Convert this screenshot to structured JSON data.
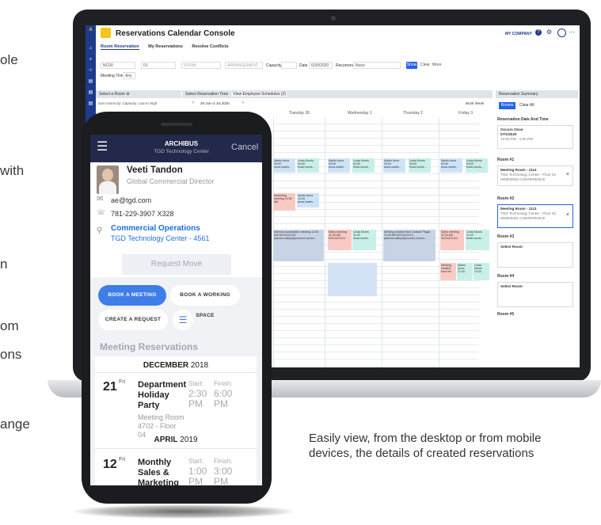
{
  "left_text_fragments": [
    "ole",
    "with",
    "n",
    "om",
    "ons",
    "ange"
  ],
  "caption": "Easily view, from the desktop or from mobile devices, the details of created reservations",
  "desktop": {
    "app_title": "Reservations Calendar Console",
    "brand": "MY COMPANY",
    "tabs": [
      "Room Reservation",
      "My Reservations",
      "Resolve Conflicts"
    ],
    "filters": {
      "site": "NC00",
      "floor": "01",
      "room_placeholder": "ROOM",
      "arrangement_placeholder": "ARRANGEMENT",
      "capacity_label": "Capacity",
      "date_label": "Date",
      "date_value": "6/30/2020",
      "recurrence_label": "Recurrence",
      "recurrence_value": "None",
      "meeting_time_label": "Meeting Time",
      "meeting_time_value": "Any"
    },
    "buttons": {
      "show": "Show",
      "clear": "Clear",
      "more": "More"
    },
    "select_room_header": "Select a Room",
    "sort_label": "Sort rooms by: Capacity: Low to High",
    "select_time_header": "Select Reservation Time",
    "view_schedules": "View Employee Schedules (2)",
    "date_range": "29 Jun–3 Jul 2020",
    "view_mode": "Work Week",
    "days": [
      "Tuesday 30",
      "Wednesday 1",
      "Thursday 2",
      "Friday 3"
    ],
    "events": [
      {
        "text": "Martin Anna 09:00 anna.martin..."
      },
      {
        "text": "Linda Morris 09:00 linda.morris..."
      },
      {
        "text": "Martin Anna 09:00 anna.martin..."
      },
      {
        "text": "Linda Morris 09:00 linda.morris..."
      },
      {
        "text": "Martin Anna 09:00 anna.martin..."
      },
      {
        "text": "Linda Morris 09:00 linda.morris..."
      },
      {
        "text": "Martin Anna 09:00 anna.martin..."
      },
      {
        "text": "Linda Morris 09:00 linda.morris..."
      },
      {
        "text": "Marketing meeting 10:00 AM"
      },
      {
        "text": "Martin Anna 10:00 anna.martin..."
      },
      {
        "text": "Internal coordination meeting 11:00 AM NC01/01/113 paloma.callejo@procos1.onmicr..."
      },
      {
        "text": "Sales meeting 11:00 AM NC01/01/114"
      },
      {
        "text": "Linda Morris 11:00 linda.morris..."
      },
      {
        "text": "Meeting created from Outlook Plugin 11:00 AM NC01/01/113 paloma.callejo@procos1.onmicr..."
      },
      {
        "text": "Sales meeting 11:00 AM NC01/01/114"
      },
      {
        "text": "Linda Morris 11:00 linda.morris..."
      },
      {
        "text": "Meeting created from the"
      },
      {
        "text": "Martin Anna 12:00"
      },
      {
        "text": "Linda Morris 12:00"
      }
    ],
    "summary": {
      "header": "Reservation Summary",
      "tab_rooms": "Rooms",
      "tab_clear": "Clear All",
      "date_time_title": "Reservation Date And Time",
      "occurs": "Occurs Once",
      "date": "07/1/2020",
      "time": "12:00 PM - 1:00 PM",
      "room1_title": "Room #1",
      "room1_name": "Meeting Room - 1114",
      "room1_detail": "TGD Technology Center - Floor 01 000000002 CONFERENCE",
      "room2_title": "Room #2",
      "room2_name": "Meeting Room - 1113",
      "room2_detail": "TGD Technology Center - Floor 01 000000001 CONFERENCE",
      "room3_title": "Room #3",
      "room4_title": "Room #4",
      "room5_title": "Room #5",
      "select_room": "Select Room"
    }
  },
  "phone": {
    "brand": "ARCHIBUS",
    "center": "TGD Technology Center",
    "cancel": "Cancel",
    "user_name": "Veeti Tandon",
    "user_title": "Global Commercial Director",
    "email": "ae@tgd.com",
    "phone": "781-229-3907 X328",
    "dept": "Commercial Operations",
    "location": "TGD Technology Center - 4561",
    "request_move": "Request Move",
    "book_meeting": "BOOK A MEETING SPACE",
    "book_working": "BOOK A WORKING SPACE",
    "create_request": "CREATE A REQUEST",
    "section_title": "Meeting Reservations",
    "month1": {
      "bold": "DECEMBER",
      "year": " 2018"
    },
    "res1": {
      "day": "21",
      "dow": "Fri",
      "title": "Department Holiday Party",
      "start_label": "Start:",
      "start": "2:30 PM",
      "finish_label": "Finish:",
      "finish": "6:00 PM",
      "room": "Meeting Room 4702 - Floor 04"
    },
    "month2": {
      "bold": "APRIL",
      "year": " 2019"
    },
    "res2": {
      "day": "12",
      "dow": "Fri",
      "title": "Monthly Sales & Marketing",
      "start_label": "Start:",
      "start": "1:00 PM",
      "finish_label": "Finish:",
      "finish": "3:00 PM"
    }
  }
}
